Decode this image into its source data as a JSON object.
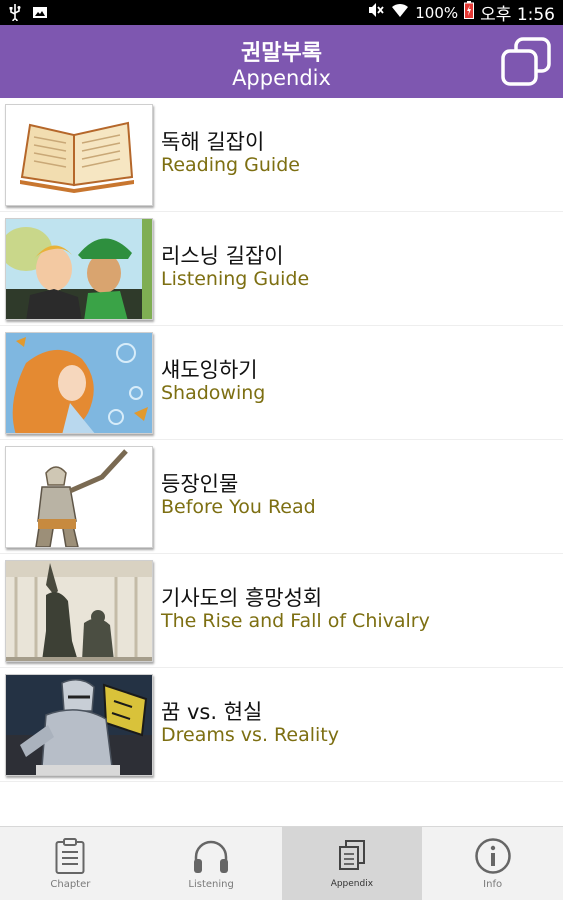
{
  "status_bar": {
    "battery_pct": "100%",
    "time": "오후 1:56"
  },
  "header": {
    "title": "권말부록",
    "subtitle": "Appendix"
  },
  "items": [
    {
      "title_ko": "독해 길잡이",
      "title_en": "Reading Guide",
      "thumb": "open-book"
    },
    {
      "title_ko": "리스닝 길잡이",
      "title_en": "Listening Guide",
      "thumb": "two-boys"
    },
    {
      "title_ko": "섀도잉하기",
      "title_en": "Shadowing",
      "thumb": "girl-underwater"
    },
    {
      "title_ko": "등장인물",
      "title_en": "Before You Read",
      "thumb": "don-quixote-figure"
    },
    {
      "title_ko": "기사도의 흥망성회",
      "title_en": "The Rise and Fall of Chivalry",
      "thumb": "knight-statue"
    },
    {
      "title_ko": "꿈 vs. 현실",
      "title_en": "Dreams vs. Reality",
      "thumb": "armored-knight"
    }
  ],
  "nav": [
    {
      "label": "Chapter",
      "icon": "clipboard-icon"
    },
    {
      "label": "Listening",
      "icon": "headphones-icon"
    },
    {
      "label": "Appendix",
      "icon": "pages-icon",
      "active": true
    },
    {
      "label": "Info",
      "icon": "info-icon"
    }
  ],
  "colors": {
    "header": "#7e57b0",
    "subtitle_en": "#7d6f12"
  }
}
